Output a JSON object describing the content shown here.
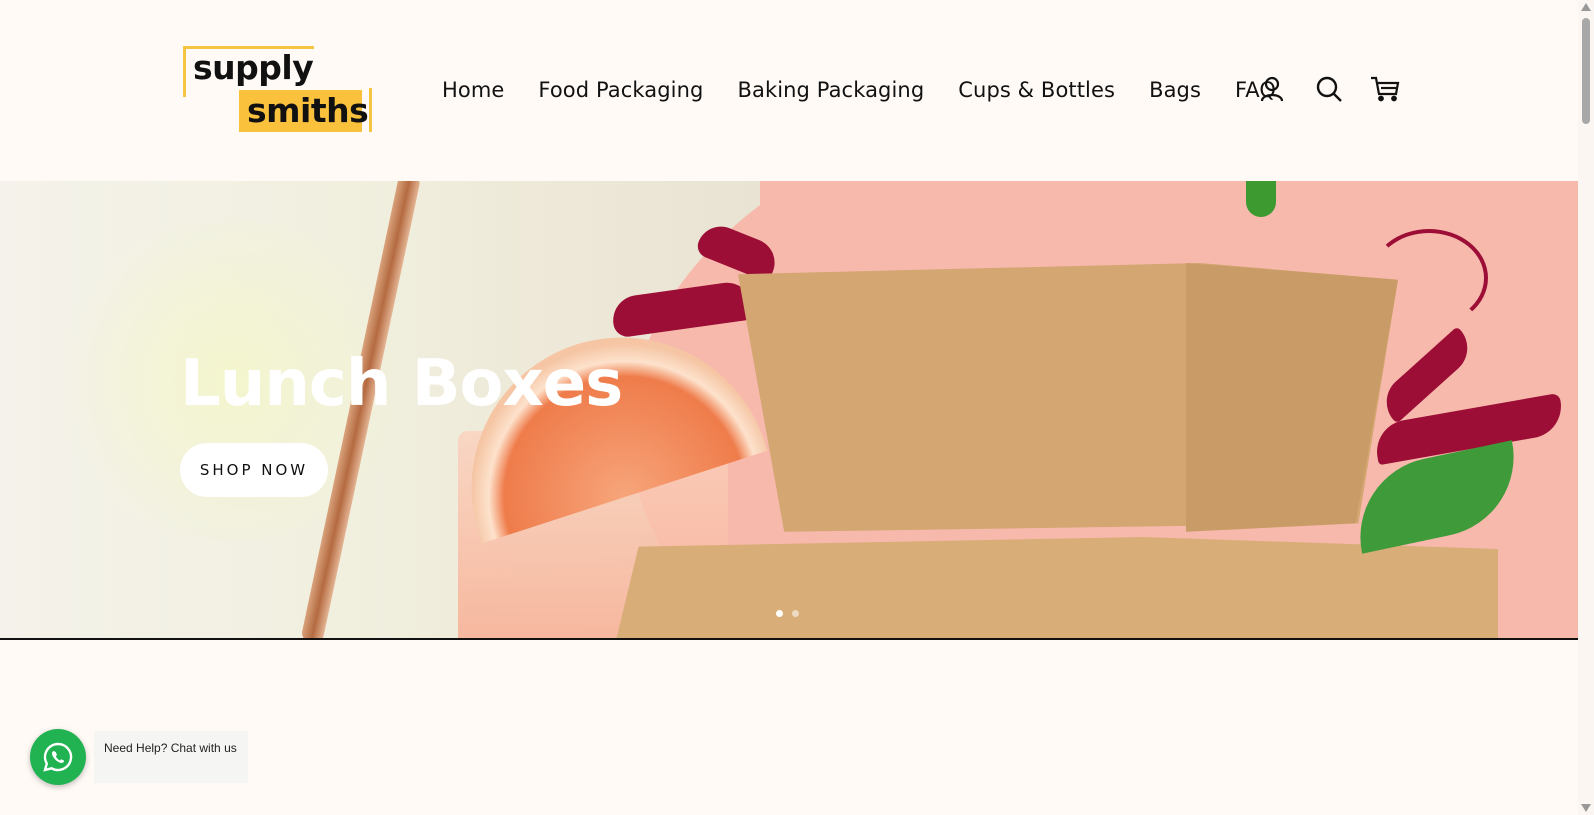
{
  "header": {
    "logo": {
      "line1": "supply",
      "line2": "smiths"
    },
    "nav": [
      {
        "label": "Home"
      },
      {
        "label": "Food Packaging"
      },
      {
        "label": "Baking Packaging"
      },
      {
        "label": "Cups & Bottles"
      },
      {
        "label": "Bags"
      },
      {
        "label": "FAQ"
      }
    ],
    "icons": {
      "account": "user-icon",
      "search": "search-icon",
      "cart": "cart-icon"
    }
  },
  "hero": {
    "title": "Lunch Boxes",
    "cta": "SHOP NOW",
    "slides": {
      "count": 2,
      "active": 1
    }
  },
  "chat_widget": {
    "icon": "whatsapp-icon",
    "label": "Need Help? Chat with us"
  },
  "colors": {
    "page_bg": "#fffaf6",
    "logo_yellow": "#f9c13c",
    "hero_pink": "#f8b9ad",
    "whatsapp_green": "#21b352"
  }
}
